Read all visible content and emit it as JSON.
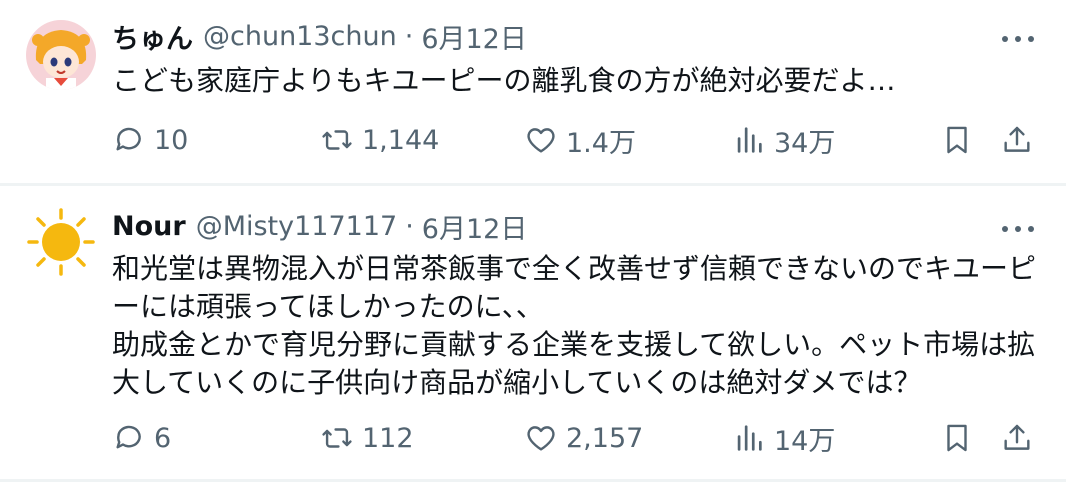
{
  "tweets": [
    {
      "display_name": "ちゅん",
      "handle": "@chun13chun",
      "separator": "·",
      "date": "6月12日",
      "text": "こども家庭庁よりもキユーピーの離乳食の方が絶対必要だよ…",
      "replies": "10",
      "retweets": "1,144",
      "likes": "1.4万",
      "views": "34万",
      "avatar_icon": "anime-girl-avatar"
    },
    {
      "display_name": "Nour",
      "handle": "@Misty117117",
      "separator": "·",
      "date": "6月12日",
      "text": "和光堂は異物混入が日常茶飯事で全く改善せず信頼できないのでキユーピーには頑張ってほしかったのに、、\n助成金とかで育児分野に貢献する企業を支援して欲しい。ペット市場は拡大していくのに子供向け商品が縮小していくのは絶対ダメでは？",
      "replies": "6",
      "retweets": "112",
      "likes": "2,157",
      "views": "14万",
      "avatar_icon": "sun-avatar"
    }
  ],
  "colors": {
    "text_primary": "#0f1419",
    "text_secondary": "#536471",
    "divider": "#eff3f4",
    "sun": "#f5b80f"
  }
}
